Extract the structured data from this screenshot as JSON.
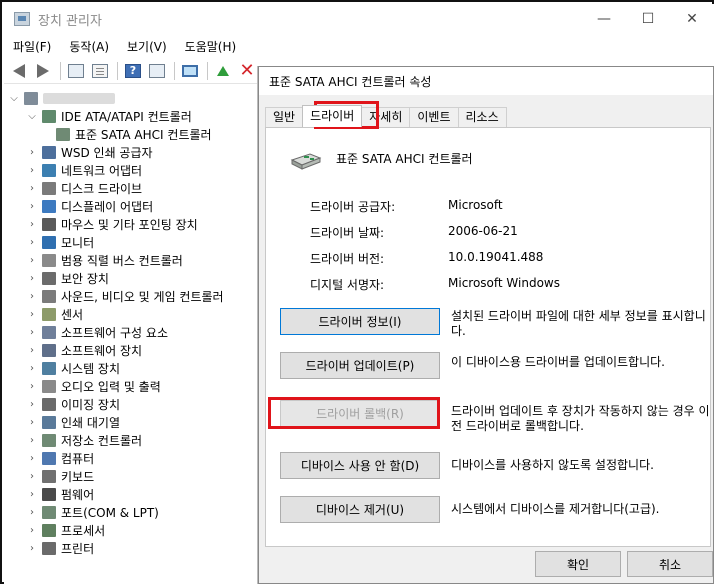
{
  "window": {
    "title": "장치 관리자",
    "menu": [
      "파일(F)",
      "동작(A)",
      "보기(V)",
      "도움말(H)"
    ]
  },
  "toolbar": {
    "icons": [
      "back-icon",
      "forward-icon",
      "properties-grid-icon",
      "document-icon",
      "help-icon",
      "update-icon",
      "monitor-icon",
      "enable-driver-icon",
      "uninstall-icon"
    ]
  },
  "tree": {
    "root_label_hidden": true,
    "expanded_category": "IDE ATA/ATAPI 컨트롤러",
    "expanded_child": "표준 SATA AHCI 컨트롤러",
    "categories": [
      "WSD 인쇄 공급자",
      "네트워크 어댑터",
      "디스크 드라이브",
      "디스플레이 어댑터",
      "마우스 및 기타 포인팅 장치",
      "모니터",
      "범용 직렬 버스 컨트롤러",
      "보안 장치",
      "사운드, 비디오 및 게임 컨트롤러",
      "센서",
      "소프트웨어 구성 요소",
      "소프트웨어 장치",
      "시스템 장치",
      "오디오 입력 및 출력",
      "이미징 장치",
      "인쇄 대기열",
      "저장소 컨트롤러",
      "컴퓨터",
      "키보드",
      "펌웨어",
      "포트(COM & LPT)",
      "프로세서",
      "프린터"
    ]
  },
  "dialog": {
    "title": "표준 SATA AHCI 컨트롤러 속성",
    "tabs": [
      "일반",
      "드라이버",
      "자세히",
      "이벤트",
      "리소스"
    ],
    "active_tab": "드라이버",
    "device_name": "표준 SATA AHCI 컨트롤러",
    "props": [
      {
        "label": "드라이버 공급자:",
        "value": "Microsoft"
      },
      {
        "label": "드라이버 날짜:",
        "value": "2006-06-21"
      },
      {
        "label": "드라이버 버전:",
        "value": "10.0.19041.488"
      },
      {
        "label": "디지털 서명자:",
        "value": "Microsoft Windows"
      }
    ],
    "actions": [
      {
        "button": "드라이버 정보(I)",
        "desc": "설치된 드라이버 파일에 대한 세부 정보를 표시합니다."
      },
      {
        "button": "드라이버 업데이트(P)",
        "desc": "이 디바이스용 드라이버를 업데이트합니다."
      },
      {
        "button": "드라이버 롤백(R)",
        "desc": "드라이버 업데이트 후 장치가 작동하지 않는 경우 이전 드라이버로 롤백합니다."
      },
      {
        "button": "디바이스 사용 안 함(D)",
        "desc": "디바이스를 사용하지 않도록 설정합니다."
      },
      {
        "button": "디바이스 제거(U)",
        "desc": "시스템에서 디바이스를 제거합니다(고급)."
      }
    ],
    "ok": "확인",
    "cancel": "취소"
  },
  "colors": {
    "highlight": "#e0141a",
    "button_focus": "#0078d7",
    "dialog_bg": "#f0f0f0"
  }
}
